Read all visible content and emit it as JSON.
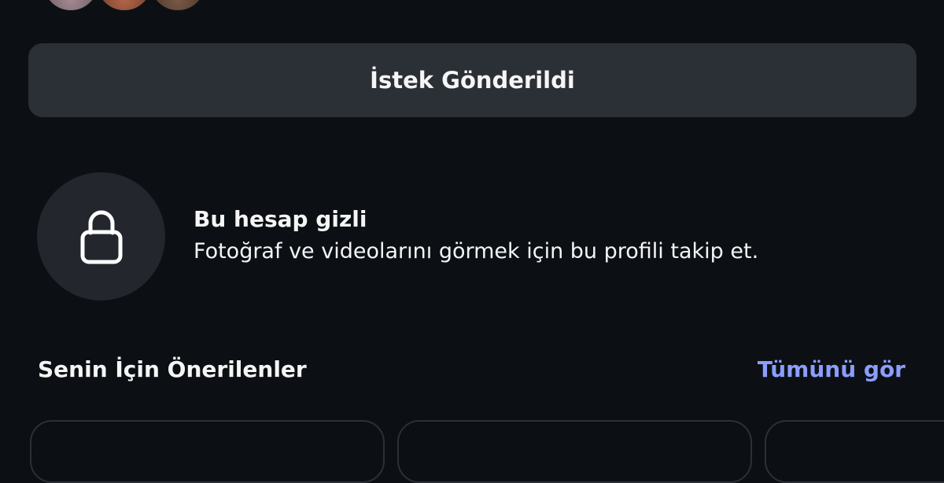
{
  "profile": {
    "follow_request_button": "İstek Gönderildi"
  },
  "private_notice": {
    "icon": "lock-icon",
    "title": "Bu hesap gizli",
    "description": "Fotoğraf ve videolarını görmek için bu profili takip et."
  },
  "suggestions": {
    "title": "Senin İçin Önerilenler",
    "see_all_label": "Tümünü gör",
    "see_all_color": "#8c9dff"
  },
  "colors": {
    "background": "#0c1014",
    "button": "#2b3036",
    "icon_circle": "#23272d"
  }
}
